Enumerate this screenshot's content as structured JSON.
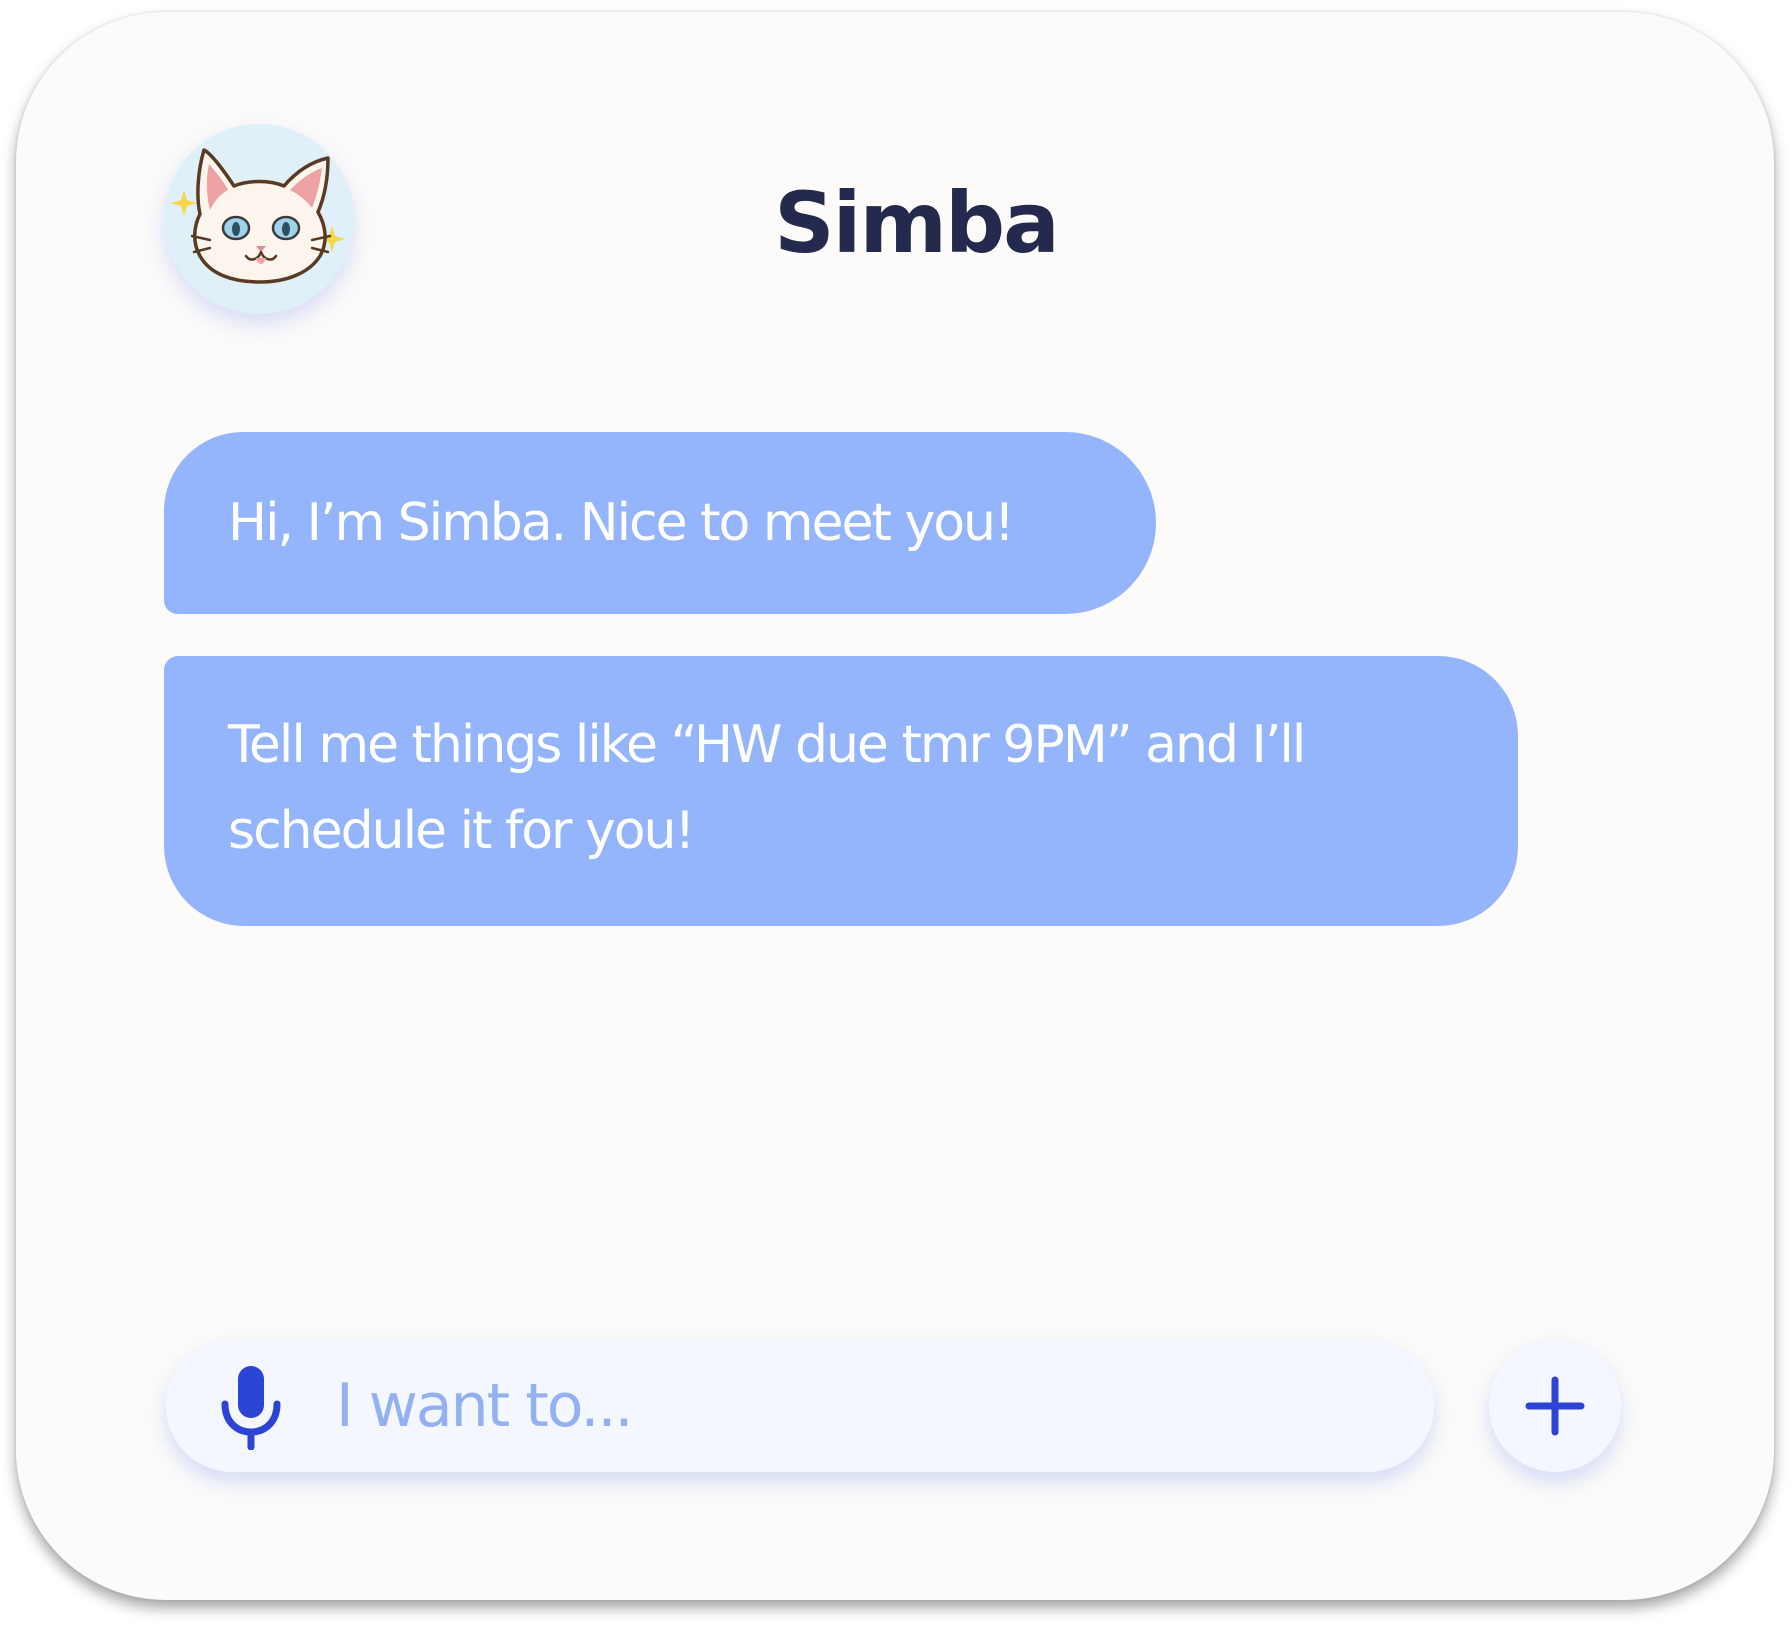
{
  "header": {
    "title": "Simba",
    "avatar_icon": "cat-avatar-icon"
  },
  "messages": [
    {
      "text": "Hi, I’m Simba. Nice to meet you!"
    },
    {
      "text": "Tell me things like “HW due tmr 9PM” and I’ll schedule it for you!"
    }
  ],
  "composer": {
    "placeholder": "I want to...",
    "mic_icon": "microphone-icon",
    "add_icon": "plus-icon"
  },
  "colors": {
    "background": "#fcfbfa",
    "bubble": "#94b4fb",
    "title": "#232a4e",
    "accent": "#2b44d3",
    "placeholder": "#93b0f2",
    "input_bg": "#f4f7ff",
    "avatar_bg": "#dff0f8"
  }
}
